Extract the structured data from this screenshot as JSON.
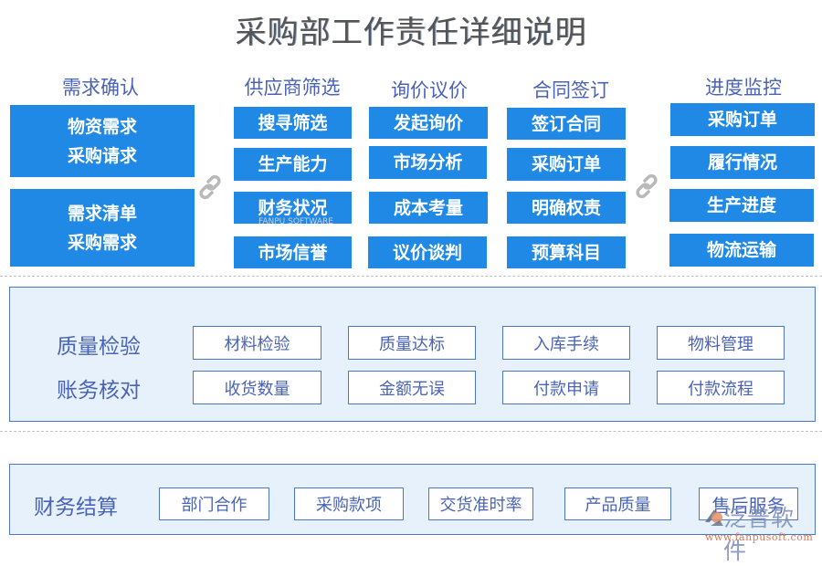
{
  "title": "采购部工作责任详细说明",
  "columns": [
    {
      "heading": "需求确认",
      "items": [
        "物资需求\n采购请求",
        "需求清单\n采购需求"
      ]
    },
    {
      "heading": "供应商筛选",
      "items": [
        "搜寻筛选",
        "生产能力",
        "财务状况",
        "市场信誉"
      ]
    },
    {
      "heading": "询价议价",
      "items": [
        "发起询价",
        "市场分析",
        "成本考量",
        "议价谈判"
      ]
    },
    {
      "heading": "合同签订",
      "items": [
        "签订合同",
        "采购订单",
        "明确权责",
        "预算科目"
      ]
    },
    {
      "heading": "进度监控",
      "items": [
        "采购订单",
        "履行情况",
        "生产进度",
        "物流运输"
      ]
    }
  ],
  "box1_lines": [
    "物资需求",
    "采购请求"
  ],
  "box2_lines": [
    "需求清单",
    "采购需求"
  ],
  "icons": {
    "connector": "link-icon"
  },
  "middle_panel": {
    "rows": [
      {
        "label": "质量检验",
        "items": [
          "材料检验",
          "质量达标",
          "入库手续",
          "物料管理"
        ]
      },
      {
        "label": "账务核对",
        "items": [
          "收货数量",
          "金额无误",
          "付款申请",
          "付款流程"
        ]
      }
    ]
  },
  "bottom_panel": {
    "label": "财务结算",
    "items": [
      "部门合作",
      "采购款项",
      "交货准时率",
      "产品质量",
      "售后服务"
    ]
  },
  "watermark": {
    "brand": "泛普软件",
    "url": "www.fanpusoft.com"
  },
  "colors": {
    "primary_blue": "#2089e6",
    "heading_blue": "#4a63b6",
    "panel_bg": "#e6f1fc",
    "panel_border": "#4a78c6"
  }
}
